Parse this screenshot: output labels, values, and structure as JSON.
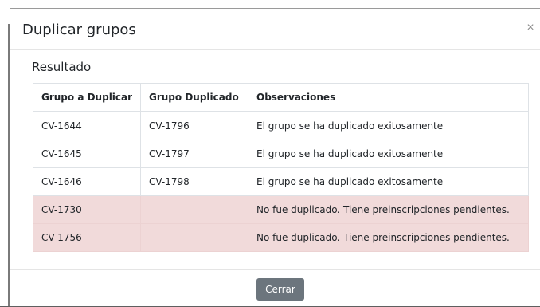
{
  "dialog": {
    "title": "Duplicar grupos",
    "close_symbol": "×",
    "close_icon": "close-icon"
  },
  "result": {
    "section_title": "Resultado",
    "columns": [
      "Grupo a Duplicar",
      "Grupo Duplicado",
      "Observaciones"
    ],
    "rows": [
      {
        "original": "CV-1644",
        "duplicate": "CV-1796",
        "observation": "El grupo se ha duplicado exitosamente",
        "status": "success"
      },
      {
        "original": "CV-1645",
        "duplicate": "CV-1797",
        "observation": "El grupo se ha duplicado exitosamente",
        "status": "success"
      },
      {
        "original": "CV-1646",
        "duplicate": "CV-1798",
        "observation": "El grupo se ha duplicado exitosamente",
        "status": "success"
      },
      {
        "original": "CV-1730",
        "duplicate": "",
        "observation": "No fue duplicado. Tiene preinscripciones pendientes.",
        "status": "danger"
      },
      {
        "original": "CV-1756",
        "duplicate": "",
        "observation": "No fue duplicado. Tiene preinscripciones pendientes.",
        "status": "danger"
      }
    ]
  },
  "footer": {
    "close_label": "Cerrar"
  },
  "colors": {
    "danger_row": "#f1dada",
    "button_secondary": "#6c757d",
    "backdrop": "#5f5f5f"
  }
}
